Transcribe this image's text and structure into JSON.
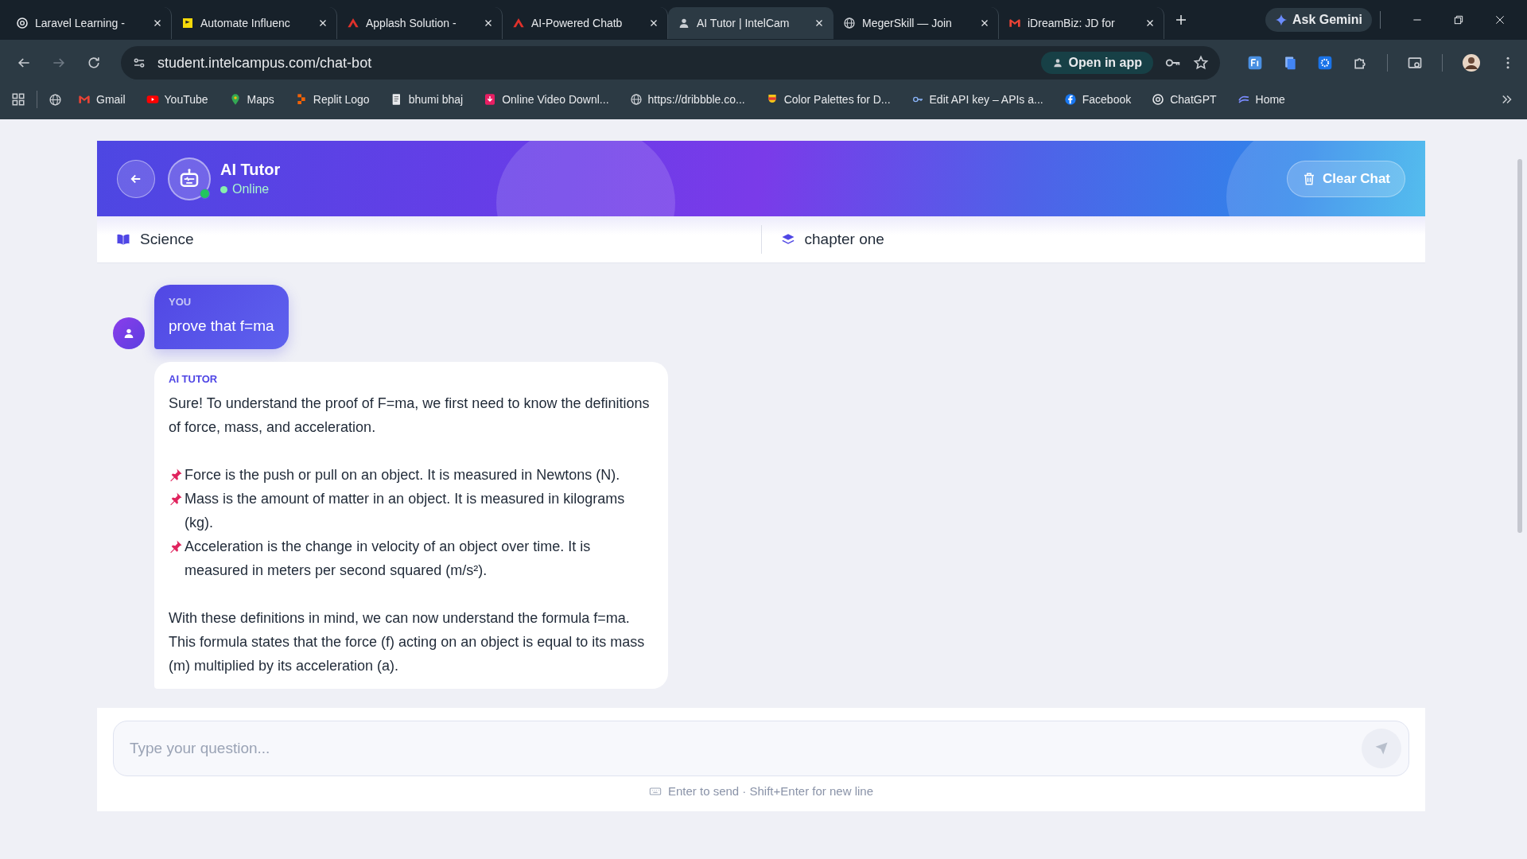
{
  "browser": {
    "tabs": [
      {
        "title": "Laravel Learning -",
        "selected": false
      },
      {
        "title": "Automate Influenc",
        "selected": false
      },
      {
        "title": "Applash Solution -",
        "selected": false
      },
      {
        "title": "AI-Powered Chatb",
        "selected": false
      },
      {
        "title": "AI Tutor | IntelCam",
        "selected": true
      },
      {
        "title": "MegerSkill — Join",
        "selected": false
      },
      {
        "title": "iDreamBiz: JD for",
        "selected": false
      }
    ],
    "ask_gemini": "Ask Gemini",
    "url": "student.intelcampus.com/chat-bot",
    "open_in_app": "Open in app",
    "bookmarks": [
      {
        "label": "Gmail"
      },
      {
        "label": "YouTube"
      },
      {
        "label": "Maps"
      },
      {
        "label": "Replit Logo"
      },
      {
        "label": "bhumi bhaj"
      },
      {
        "label": "Online Video Downl..."
      },
      {
        "label": "https://dribbble.co..."
      },
      {
        "label": "Color Palettes for D..."
      },
      {
        "label": "Edit API key – APIs a..."
      },
      {
        "label": "Facebook"
      },
      {
        "label": "ChatGPT"
      },
      {
        "label": "Home"
      }
    ]
  },
  "chat": {
    "title": "AI Tutor",
    "status": "Online",
    "online": true,
    "clear_button": "Clear Chat",
    "subject": "Science",
    "chapter": "chapter one",
    "messages": [
      {
        "kind": "user",
        "author": "YOU",
        "blocks": [
          {
            "kind": "paragraph",
            "text": "prove that f=ma"
          }
        ]
      },
      {
        "kind": "ai",
        "author": "AI TUTOR",
        "blocks": [
          {
            "kind": "paragraph",
            "text": "Sure! To understand the proof of F=ma, we first need to know the definitions of force, mass, and acceleration."
          },
          {
            "kind": "pin",
            "text": "Force is the push or pull on an object. It is measured in Newtons (N)."
          },
          {
            "kind": "pin",
            "text": "Mass is the amount of matter in an object. It is measured in kilograms (kg)."
          },
          {
            "kind": "pin",
            "text": "Acceleration is the change in velocity of an object over time. It is measured in meters per second squared (m/s²)."
          },
          {
            "kind": "paragraph",
            "text": "With these definitions in mind, we can now understand the formula f=ma. This formula states that the force (f) acting on an object is equal to its mass (m) multiplied by its acceleration (a)."
          }
        ]
      }
    ],
    "input": {
      "placeholder": "Type your question..."
    },
    "hint": "Enter to send · Shift+Enter for new line"
  }
}
